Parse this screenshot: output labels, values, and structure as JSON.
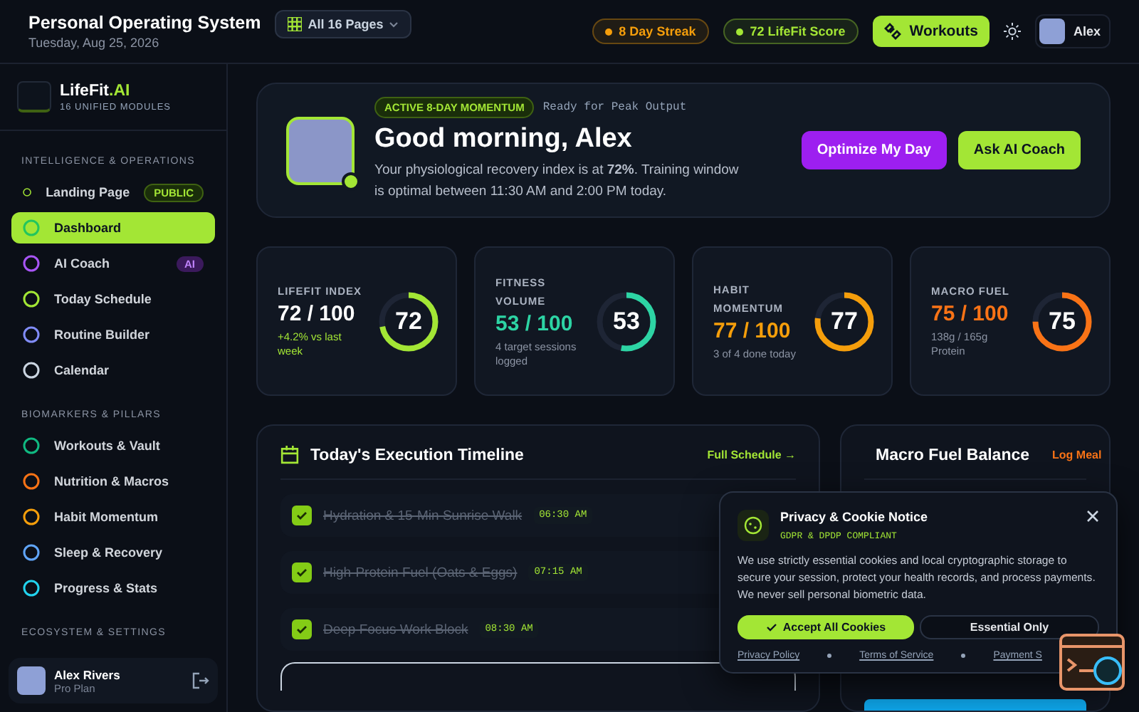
{
  "topbar": {
    "title": "Personal Operating System",
    "date": "Tuesday, Aug 25, 2026",
    "pages_menu": "All 16 Pages",
    "chips": [
      {
        "text": "8 Day Streak",
        "color": "#f59e0b"
      },
      {
        "text": "72 LifeFit Score",
        "color": "#a3e635"
      }
    ],
    "workouts_button": "Workouts",
    "user": "Alex"
  },
  "sidebar": {
    "brand": "LifeFit",
    "brand_accent": ".AI",
    "subtitle": "16 UNIFIED MODULES",
    "sections": [
      {
        "title": "INTELLIGENCE & OPERATIONS",
        "items": [
          {
            "label": "Landing Page",
            "selected": false,
            "color": "#a3e635",
            "badge": {
              "text": "PUBLIC",
              "kind": "public"
            }
          },
          {
            "label": "Dashboard",
            "selected": true,
            "color": "#22c55e"
          },
          {
            "label": "AI Coach",
            "selected": false,
            "color": "#a855f7",
            "badge": {
              "text": "AI",
              "kind": "ai"
            }
          },
          {
            "label": "Today Schedule",
            "selected": false,
            "color": "#a3e635"
          },
          {
            "label": "Routine Builder",
            "selected": false,
            "color": "#818cf8"
          },
          {
            "label": "Calendar",
            "selected": false,
            "color": "#cbd5e1"
          }
        ]
      },
      {
        "title": "BIOMARKERS & PILLARS",
        "items": [
          {
            "label": "Workouts & Vault",
            "selected": false,
            "color": "#10b981"
          },
          {
            "label": "Nutrition & Macros",
            "selected": false,
            "color": "#f97316"
          },
          {
            "label": "Habit Momentum",
            "selected": false,
            "color": "#f59e0b"
          },
          {
            "label": "Sleep & Recovery",
            "selected": false,
            "color": "#60a5fa"
          },
          {
            "label": "Progress & Stats",
            "selected": false,
            "color": "#22d3ee"
          }
        ]
      },
      {
        "title": "ECOSYSTEM & SETTINGS"
      }
    ],
    "user": {
      "name": "Alex Rivers",
      "plan": "Pro Plan"
    }
  },
  "hero": {
    "badge": "ACTIVE 8-DAY MOMENTUM",
    "tag": "Ready for Peak Output",
    "greeting": "Good morning, Alex",
    "text": "Your physiological recovery index is at **72%**. Training window is optimal between 11:30 AM and 2:00 PM today.",
    "buttons": [
      {
        "label": "Optimize My Day",
        "kind": "purple"
      },
      {
        "label": "Ask AI Coach",
        "kind": "green"
      }
    ]
  },
  "stats": [
    {
      "label": "LIFEFIT INDEX",
      "value": "72 / 100",
      "ring": "72",
      "note": "+4.2% vs last week",
      "level": 0.72,
      "color": "#a3e635",
      "kind": "trend"
    },
    {
      "label": "FITNESS VOLUME",
      "value": "53 / 100",
      "ring": "53",
      "note": "4 target sessions logged",
      "level": 0.53,
      "color": "#2dd4a4",
      "kind": "detail"
    },
    {
      "label": "HABIT MOMENTUM",
      "value": "77 / 100",
      "ring": "77",
      "note": "3 of 4 done today",
      "level": 0.77,
      "color": "#f59e0b",
      "kind": "detail"
    },
    {
      "label": "MACRO FUEL",
      "value": "75 / 100",
      "ring": "75",
      "note": "138g / 165g Protein",
      "level": 0.75,
      "color": "#f97316",
      "kind": "detail"
    }
  ],
  "timeline": {
    "title": "Today's Execution Timeline",
    "link": "Full Schedule →",
    "items": [
      {
        "text": "Hydration & 15-Min Sunrise Walk",
        "time": "06:30 AM",
        "done": true
      },
      {
        "text": "High-Protein Fuel (Oats & Eggs)",
        "time": "07:15 AM",
        "done": true
      },
      {
        "text": "Deep Focus Work Block",
        "time": "08:30 AM",
        "done": true
      }
    ]
  },
  "macro": {
    "title": "Macro Fuel Balance",
    "link": "Log Meal"
  },
  "cookie": {
    "title": "Privacy & Cookie Notice",
    "subtitle": "GDPR & DPDP COMPLIANT",
    "body": "We use strictly essential cookies and local cryptographic storage to secure your session, protect your health records, and process payments. We never sell personal biometric data.",
    "accept": "Accept All Cookies",
    "essential": "Essential Only",
    "links": [
      "Privacy Policy",
      "Terms of Service",
      "Payment S"
    ]
  }
}
